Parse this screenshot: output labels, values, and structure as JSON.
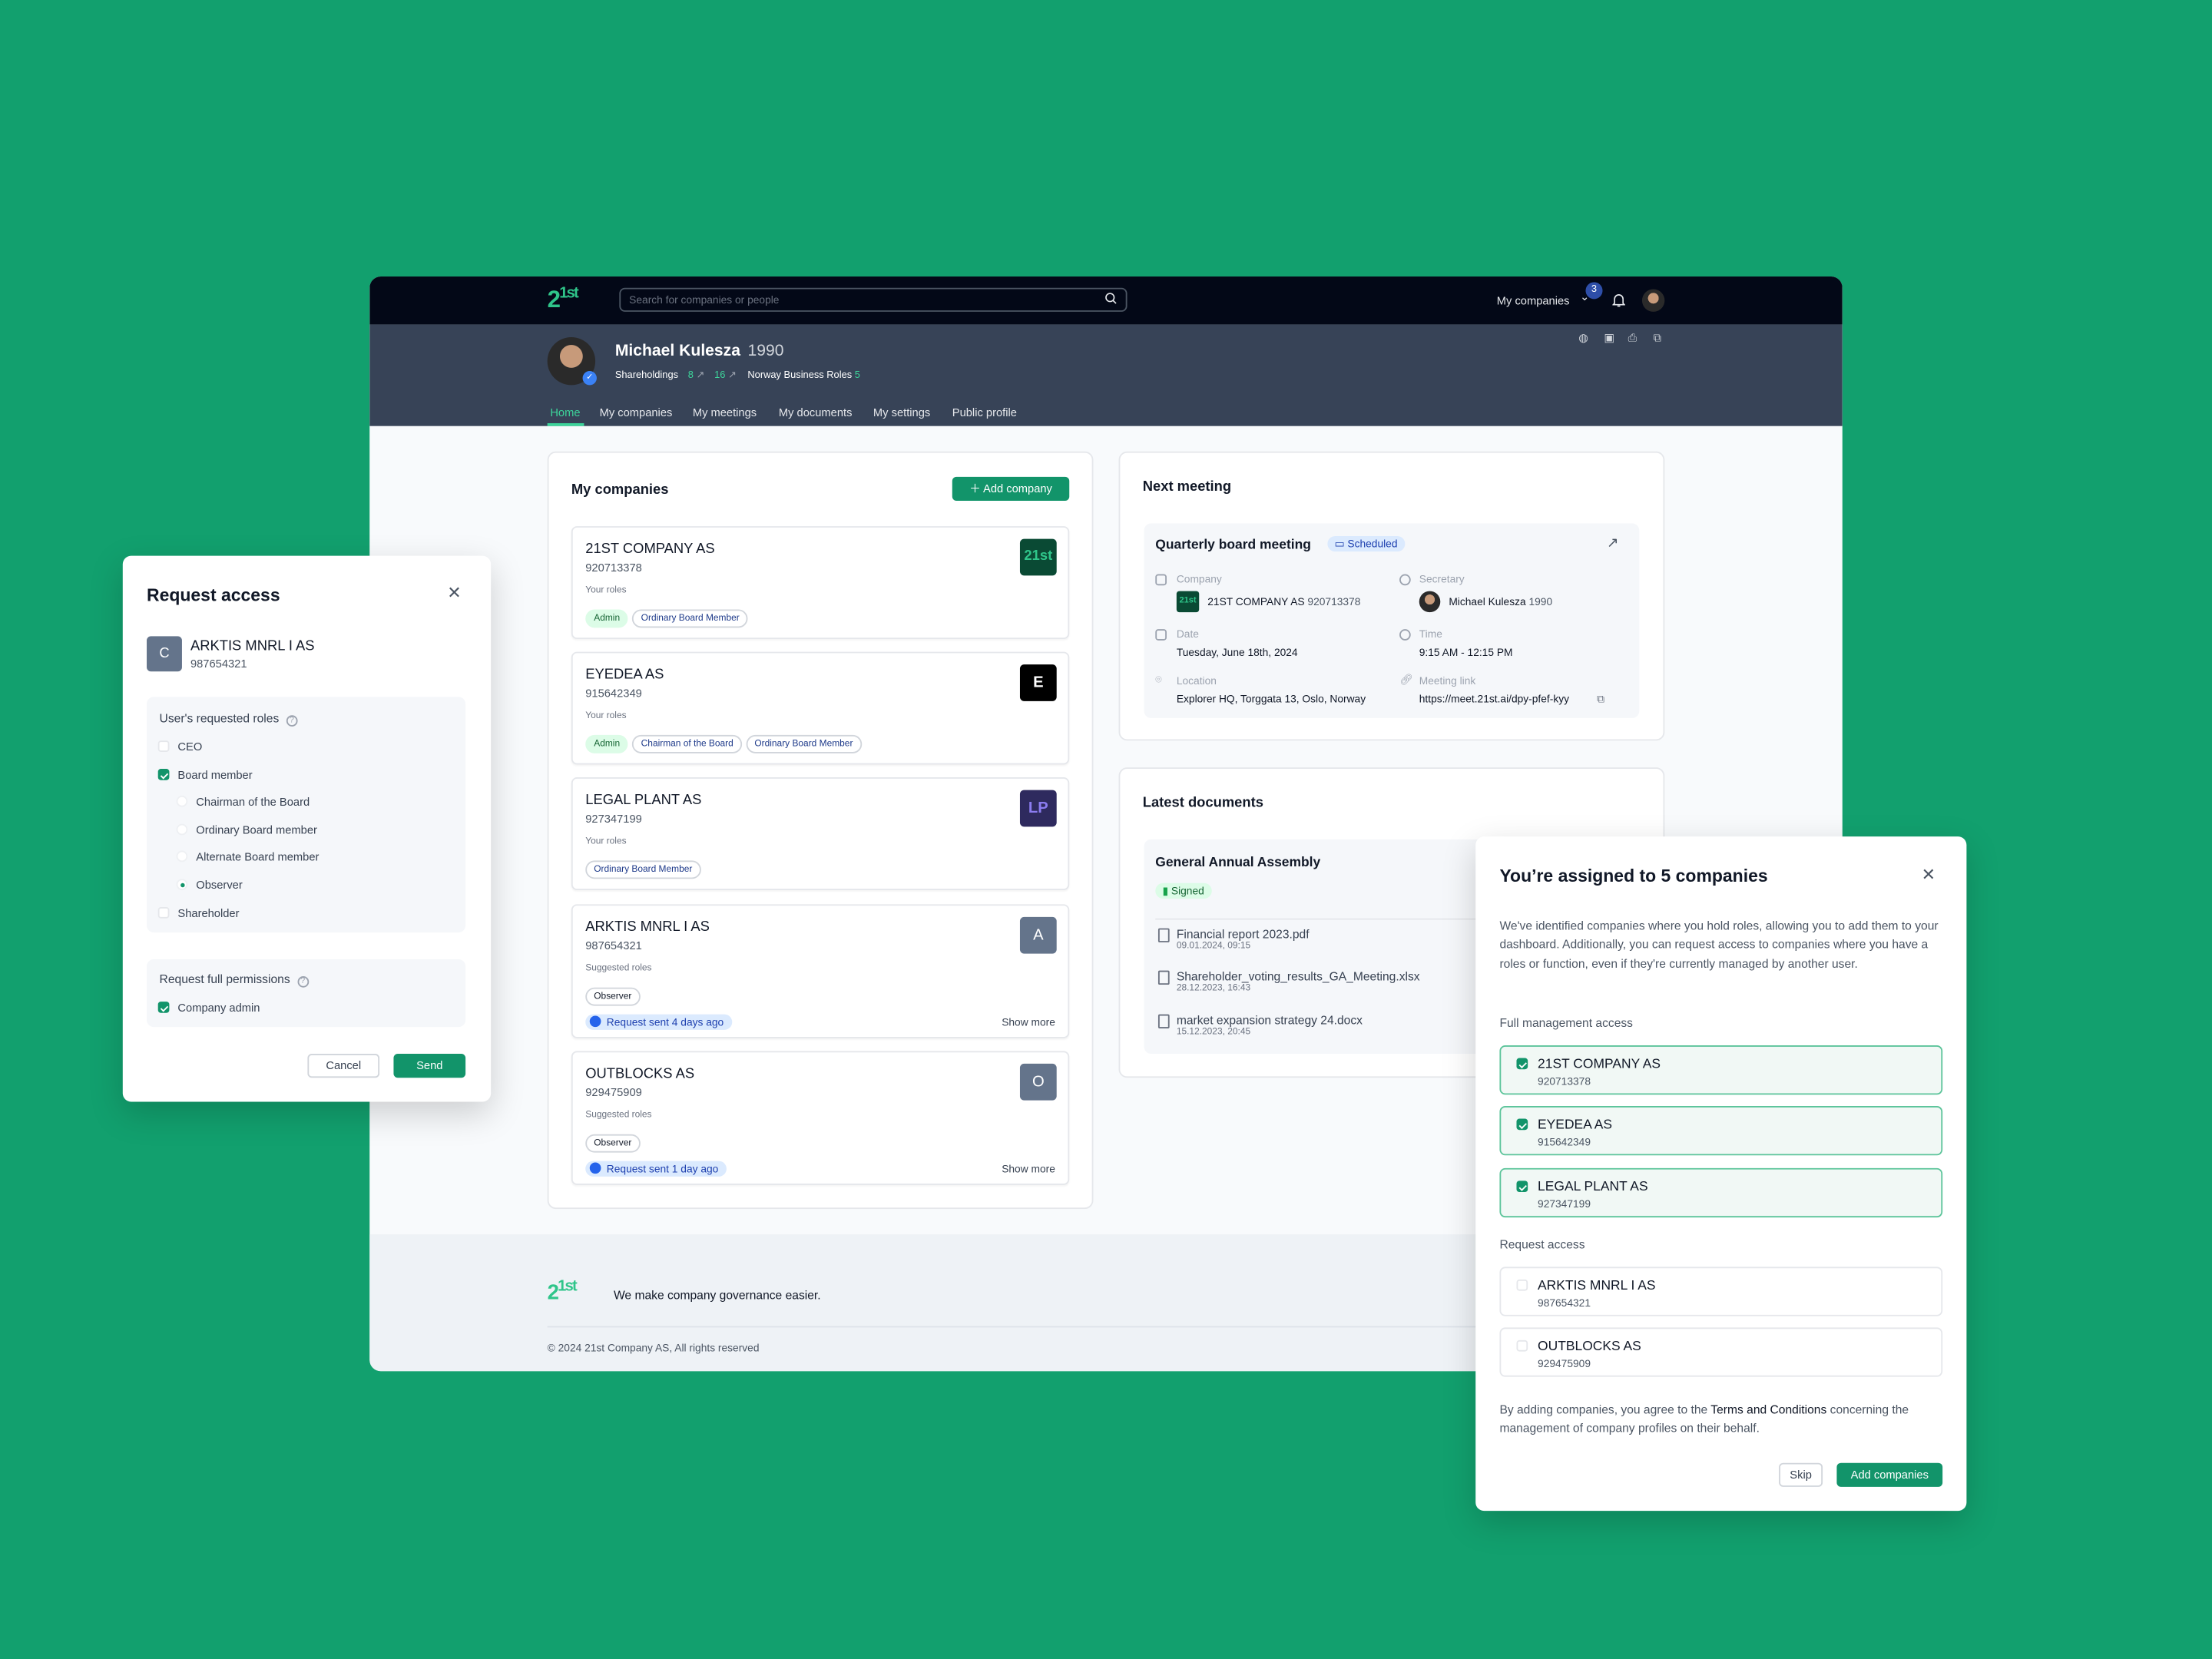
{
  "colors": {
    "background": "#12a06e",
    "accent": "#12946a",
    "topbar": "#030817",
    "profile_band": "#374357"
  },
  "topbar": {
    "logo": "21st",
    "search_placeholder": "Search for companies or people",
    "search_icon": "search-icon",
    "my_companies": "My companies",
    "notification_count": "3"
  },
  "profile": {
    "name": "Michael Kulesza",
    "year": "1990",
    "shareholdings_label": "Shareholdings",
    "shareholdings_a": "8",
    "shareholdings_b": "16",
    "roles_label": "Norway Business Roles",
    "roles_count": "5",
    "verified": true
  },
  "tabs": [
    {
      "label": "Home",
      "active": true
    },
    {
      "label": "My companies"
    },
    {
      "label": "My meetings"
    },
    {
      "label": "My documents"
    },
    {
      "label": "My settings"
    },
    {
      "label": "Public profile"
    }
  ],
  "companies": {
    "title": "My companies",
    "add_button": "Add company",
    "items": [
      {
        "name": "21ST COMPANY AS",
        "number": "920713378",
        "roles_label": "Your roles",
        "roles": [
          "Admin",
          "Ordinary Board Member"
        ],
        "logo": "21st"
      },
      {
        "name": "EYEDEA AS",
        "number": "915642349",
        "roles_label": "Your roles",
        "roles": [
          "Admin",
          "Chairman of the Board",
          "Ordinary Board Member"
        ],
        "logo": "E"
      },
      {
        "name": "LEGAL PLANT AS",
        "number": "927347199",
        "roles_label": "Your roles",
        "roles": [
          "Ordinary Board Member"
        ],
        "logo": "LP"
      },
      {
        "name": "ARKTIS MNRL I AS",
        "number": "987654321",
        "roles_label": "Suggested roles",
        "roles": [
          "Observer"
        ],
        "logo": "A",
        "request": "Request sent 4 days ago",
        "more": "Show more"
      },
      {
        "name": "OUTBLOCKS AS",
        "number": "929475909",
        "roles_label": "Suggested roles",
        "roles": [
          "Observer"
        ],
        "logo": "O",
        "request": "Request sent 1 day ago",
        "more": "Show more"
      }
    ]
  },
  "meeting": {
    "title": "Next meeting",
    "name": "Quarterly board meeting",
    "status": "Scheduled",
    "company_label": "Company",
    "company_name": "21ST COMPANY AS",
    "company_number": "920713378",
    "secretary_label": "Secretary",
    "secretary_name": "Michael Kulesza",
    "secretary_year": "1990",
    "date_label": "Date",
    "date": "Tuesday, June 18th, 2024",
    "time_label": "Time",
    "time": "9:15 AM - 12:15 PM",
    "location_label": "Location",
    "location": "Explorer HQ, Torggata 13, Oslo, Norway",
    "link_label": "Meeting link",
    "link": "https://meet.21st.ai/dpy-pfef-kyy"
  },
  "documents": {
    "title": "Latest documents",
    "group": "General Annual Assembly",
    "status": "Signed",
    "items": [
      {
        "name": "Financial report 2023.pdf",
        "date": "09.01.2024, 09:15"
      },
      {
        "name": "Shareholder_voting_results_GA_Meeting.xlsx",
        "date": "28.12.2023, 16:43"
      },
      {
        "name": "market expansion strategy 24.docx",
        "date": "15.12.2023, 20:45"
      }
    ]
  },
  "footer": {
    "logo": "21st",
    "tagline": "We make company governance easier.",
    "copyright": "© 2024 21st Company AS, All rights reserved"
  },
  "request_modal": {
    "title": "Request access",
    "company_initial": "C",
    "company_name": "ARKTIS MNRL I AS",
    "company_number": "987654321",
    "roles_label": "User's requested roles",
    "roles": [
      {
        "label": "CEO",
        "checked": false
      },
      {
        "label": "Board member",
        "checked": true
      },
      {
        "label": "Chairman of the Board",
        "checked": false
      },
      {
        "label": "Ordinary Board member",
        "checked": false
      },
      {
        "label": "Alternate Board member",
        "checked": false
      },
      {
        "label": "Observer",
        "checked": true
      },
      {
        "label": "Shareholder",
        "checked": false
      }
    ],
    "permissions_label": "Request full permissions",
    "permission": "Company admin",
    "permission_checked": true,
    "cancel": "Cancel",
    "send": "Send"
  },
  "assigned_modal": {
    "title": "You’re assigned to 5 companies",
    "description": "We've identified companies where you hold roles, allowing you to add them to your dashboard. Additionally, you can request access to companies where you have a roles or function, even if they're currently managed by another user.",
    "full_label": "Full management access",
    "full": [
      {
        "name": "21ST COMPANY AS",
        "number": "920713378",
        "checked": true
      },
      {
        "name": "EYEDEA AS",
        "number": "915642349",
        "checked": true
      },
      {
        "name": "LEGAL PLANT AS",
        "number": "927347199",
        "checked": true
      }
    ],
    "request_label": "Request access",
    "request": [
      {
        "name": "ARKTIS MNRL I AS",
        "number": "987654321",
        "checked": false
      },
      {
        "name": "OUTBLOCKS AS",
        "number": "929475909",
        "checked": false
      }
    ],
    "terms_pre": "By adding companies, you agree to the ",
    "terms_link": "Terms and Conditions",
    "terms_post": " concerning the management of company profiles on their behalf.",
    "skip": "Skip",
    "add": "Add companies"
  }
}
